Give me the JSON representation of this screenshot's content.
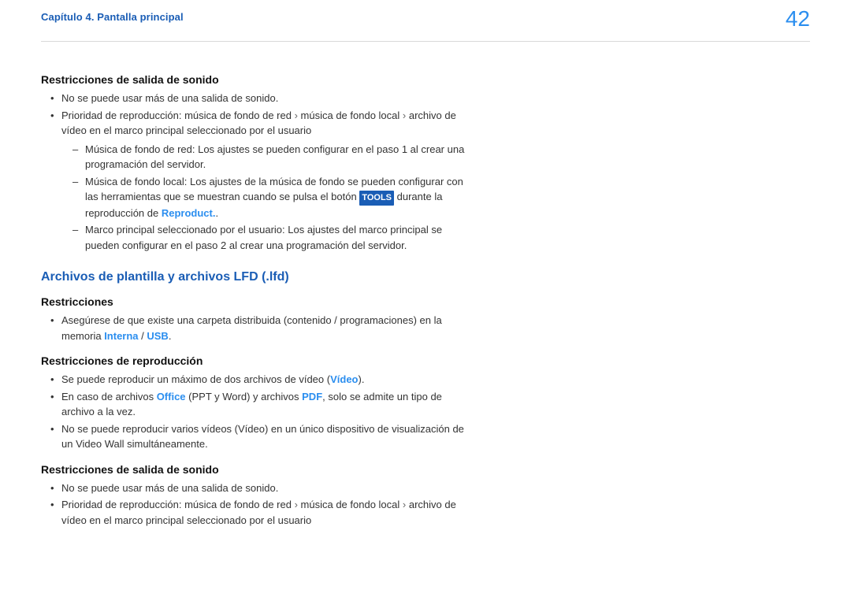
{
  "header": {
    "chapter": "Capítulo 4. Pantalla principal",
    "page_number": "42"
  },
  "sec1": {
    "title": "Restricciones de salida de sonido",
    "b1": "No se puede usar más de una salida de sonido.",
    "b2a": "Prioridad de reproducción: música de fondo de red ",
    "gt1": "›",
    "b2b": " música de fondo local ",
    "gt2": "›",
    "b2c": " archivo de vídeo en el marco principal seleccionado por el usuario",
    "d1": "Música de fondo de red: Los ajustes se pueden configurar en el paso 1 al crear una programación del servidor.",
    "d2a": "Música de fondo local: Los ajustes de la música de fondo se pueden configurar con las herramientas que se muestran cuando se pulsa el botón ",
    "d2_tools": "TOOLS",
    "d2b": " durante la reproducción de ",
    "d2_reproduct": "Reproduct.",
    "d2c": ".",
    "d3": "Marco principal seleccionado por el usuario: Los ajustes del marco principal se pueden configurar en el paso 2 al crear una programación del servidor."
  },
  "sec2": {
    "title": "Archivos de plantilla y archivos LFD (.lfd)",
    "sub1": "Restricciones",
    "r1a": "Asegúrese de que existe una carpeta distribuida (contenido / programaciones) en la memoria ",
    "r1_interna": "Interna",
    "r1_sep": " / ",
    "r1_usb": "USB",
    "r1b": ".",
    "sub2": "Restricciones de reproducción",
    "p1a": "Se puede reproducir un máximo de dos archivos de vídeo (",
    "p1_video": "Vídeo",
    "p1b": ").",
    "p2a": "En caso de archivos ",
    "p2_office": "Office",
    "p2b": " (PPT y Word) y archivos ",
    "p2_pdf": "PDF",
    "p2c": ", solo se admite un tipo de archivo a la vez.",
    "p3": "No se puede reproducir varios vídeos (Vídeo) en un único dispositivo de visualización de un Video Wall simultáneamente.",
    "sub3": "Restricciones de salida de sonido",
    "s1": "No se puede usar más de una salida de sonido.",
    "s2a": "Prioridad de reproducción: música de fondo de red ",
    "s2gt1": "›",
    "s2b": " música de fondo local ",
    "s2gt2": "›",
    "s2c": " archivo de vídeo en el marco principal seleccionado por el usuario"
  }
}
